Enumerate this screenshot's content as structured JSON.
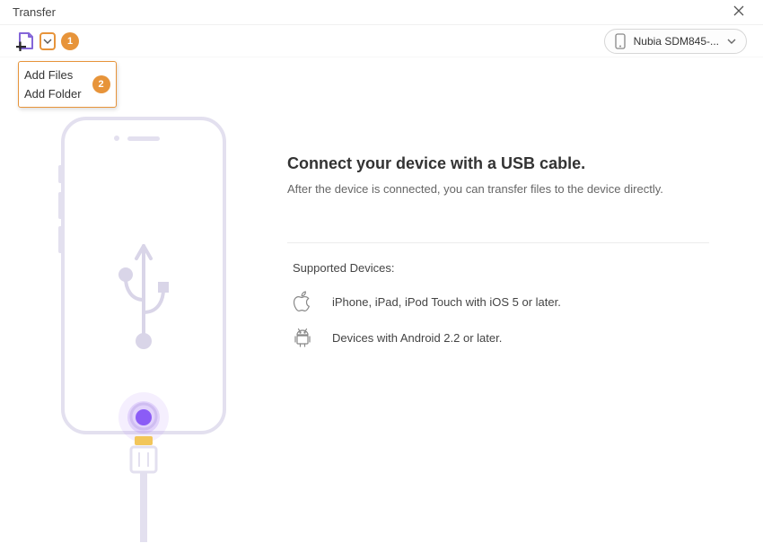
{
  "window": {
    "title": "Transfer"
  },
  "toolbar": {
    "dropdown": {
      "callout1": "1",
      "callout2": "2",
      "items": [
        "Add Files",
        "Add Folder"
      ]
    },
    "device_selected": "Nubia SDM845-..."
  },
  "main": {
    "heading": "Connect your device with a USB cable.",
    "subtext": "After the device is connected, you can transfer files to the device directly.",
    "supported_title": "Supported Devices:",
    "supported": {
      "apple": "iPhone, iPad, iPod Touch with iOS 5 or later.",
      "android": "Devices with Android 2.2 or later."
    }
  }
}
